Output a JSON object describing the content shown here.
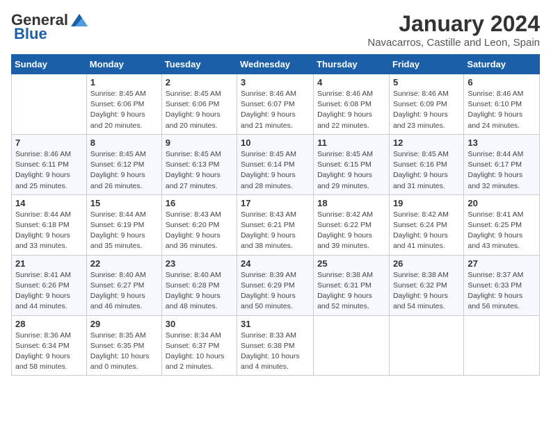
{
  "header": {
    "logo_general": "General",
    "logo_blue": "Blue",
    "month_title": "January 2024",
    "location": "Navacarros, Castille and Leon, Spain"
  },
  "days_of_week": [
    "Sunday",
    "Monday",
    "Tuesday",
    "Wednesday",
    "Thursday",
    "Friday",
    "Saturday"
  ],
  "weeks": [
    [
      {
        "day": "",
        "info": ""
      },
      {
        "day": "1",
        "info": "Sunrise: 8:45 AM\nSunset: 6:06 PM\nDaylight: 9 hours\nand 20 minutes."
      },
      {
        "day": "2",
        "info": "Sunrise: 8:45 AM\nSunset: 6:06 PM\nDaylight: 9 hours\nand 20 minutes."
      },
      {
        "day": "3",
        "info": "Sunrise: 8:46 AM\nSunset: 6:07 PM\nDaylight: 9 hours\nand 21 minutes."
      },
      {
        "day": "4",
        "info": "Sunrise: 8:46 AM\nSunset: 6:08 PM\nDaylight: 9 hours\nand 22 minutes."
      },
      {
        "day": "5",
        "info": "Sunrise: 8:46 AM\nSunset: 6:09 PM\nDaylight: 9 hours\nand 23 minutes."
      },
      {
        "day": "6",
        "info": "Sunrise: 8:46 AM\nSunset: 6:10 PM\nDaylight: 9 hours\nand 24 minutes."
      }
    ],
    [
      {
        "day": "7",
        "info": "Sunrise: 8:46 AM\nSunset: 6:11 PM\nDaylight: 9 hours\nand 25 minutes."
      },
      {
        "day": "8",
        "info": "Sunrise: 8:45 AM\nSunset: 6:12 PM\nDaylight: 9 hours\nand 26 minutes."
      },
      {
        "day": "9",
        "info": "Sunrise: 8:45 AM\nSunset: 6:13 PM\nDaylight: 9 hours\nand 27 minutes."
      },
      {
        "day": "10",
        "info": "Sunrise: 8:45 AM\nSunset: 6:14 PM\nDaylight: 9 hours\nand 28 minutes."
      },
      {
        "day": "11",
        "info": "Sunrise: 8:45 AM\nSunset: 6:15 PM\nDaylight: 9 hours\nand 29 minutes."
      },
      {
        "day": "12",
        "info": "Sunrise: 8:45 AM\nSunset: 6:16 PM\nDaylight: 9 hours\nand 31 minutes."
      },
      {
        "day": "13",
        "info": "Sunrise: 8:44 AM\nSunset: 6:17 PM\nDaylight: 9 hours\nand 32 minutes."
      }
    ],
    [
      {
        "day": "14",
        "info": "Sunrise: 8:44 AM\nSunset: 6:18 PM\nDaylight: 9 hours\nand 33 minutes."
      },
      {
        "day": "15",
        "info": "Sunrise: 8:44 AM\nSunset: 6:19 PM\nDaylight: 9 hours\nand 35 minutes."
      },
      {
        "day": "16",
        "info": "Sunrise: 8:43 AM\nSunset: 6:20 PM\nDaylight: 9 hours\nand 36 minutes."
      },
      {
        "day": "17",
        "info": "Sunrise: 8:43 AM\nSunset: 6:21 PM\nDaylight: 9 hours\nand 38 minutes."
      },
      {
        "day": "18",
        "info": "Sunrise: 8:42 AM\nSunset: 6:22 PM\nDaylight: 9 hours\nand 39 minutes."
      },
      {
        "day": "19",
        "info": "Sunrise: 8:42 AM\nSunset: 6:24 PM\nDaylight: 9 hours\nand 41 minutes."
      },
      {
        "day": "20",
        "info": "Sunrise: 8:41 AM\nSunset: 6:25 PM\nDaylight: 9 hours\nand 43 minutes."
      }
    ],
    [
      {
        "day": "21",
        "info": "Sunrise: 8:41 AM\nSunset: 6:26 PM\nDaylight: 9 hours\nand 44 minutes."
      },
      {
        "day": "22",
        "info": "Sunrise: 8:40 AM\nSunset: 6:27 PM\nDaylight: 9 hours\nand 46 minutes."
      },
      {
        "day": "23",
        "info": "Sunrise: 8:40 AM\nSunset: 6:28 PM\nDaylight: 9 hours\nand 48 minutes."
      },
      {
        "day": "24",
        "info": "Sunrise: 8:39 AM\nSunset: 6:29 PM\nDaylight: 9 hours\nand 50 minutes."
      },
      {
        "day": "25",
        "info": "Sunrise: 8:38 AM\nSunset: 6:31 PM\nDaylight: 9 hours\nand 52 minutes."
      },
      {
        "day": "26",
        "info": "Sunrise: 8:38 AM\nSunset: 6:32 PM\nDaylight: 9 hours\nand 54 minutes."
      },
      {
        "day": "27",
        "info": "Sunrise: 8:37 AM\nSunset: 6:33 PM\nDaylight: 9 hours\nand 56 minutes."
      }
    ],
    [
      {
        "day": "28",
        "info": "Sunrise: 8:36 AM\nSunset: 6:34 PM\nDaylight: 9 hours\nand 58 minutes."
      },
      {
        "day": "29",
        "info": "Sunrise: 8:35 AM\nSunset: 6:35 PM\nDaylight: 10 hours\nand 0 minutes."
      },
      {
        "day": "30",
        "info": "Sunrise: 8:34 AM\nSunset: 6:37 PM\nDaylight: 10 hours\nand 2 minutes."
      },
      {
        "day": "31",
        "info": "Sunrise: 8:33 AM\nSunset: 6:38 PM\nDaylight: 10 hours\nand 4 minutes."
      },
      {
        "day": "",
        "info": ""
      },
      {
        "day": "",
        "info": ""
      },
      {
        "day": "",
        "info": ""
      }
    ]
  ]
}
